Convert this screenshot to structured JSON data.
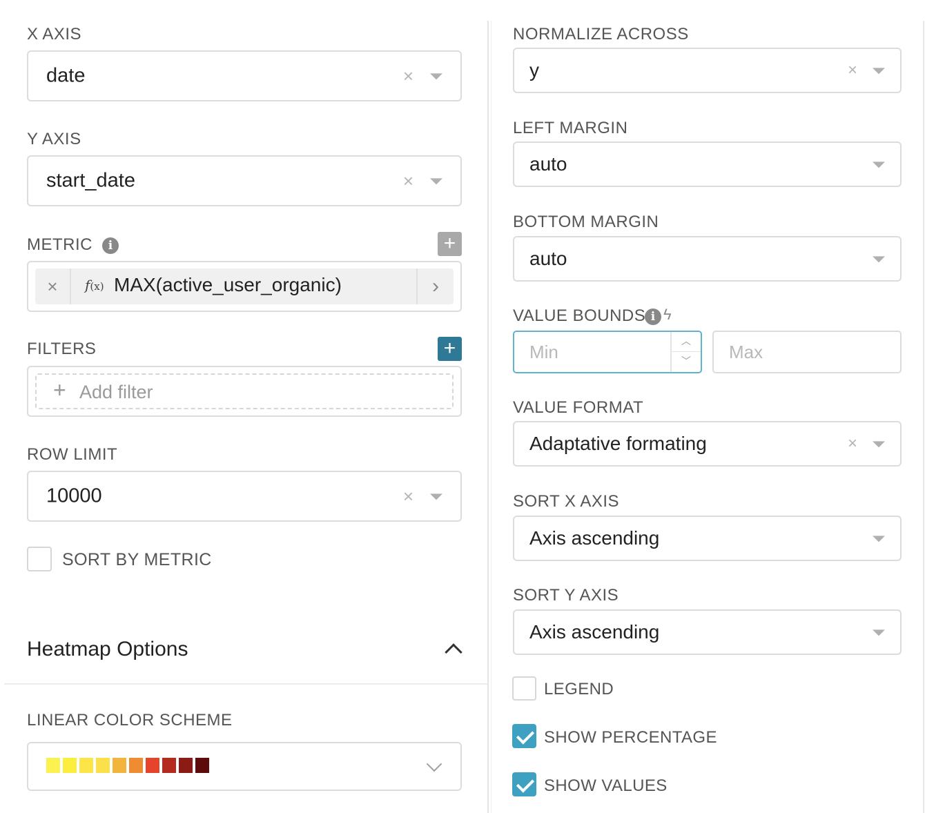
{
  "left": {
    "x_axis": {
      "label": "X AXIS",
      "value": "date"
    },
    "y_axis": {
      "label": "Y AXIS",
      "value": "start_date"
    },
    "metric": {
      "label": "METRIC",
      "fx": "f",
      "fx_sub": "(x)",
      "value": "MAX(active_user_organic)"
    },
    "filters": {
      "label": "FILTERS",
      "add_label": "Add filter"
    },
    "row_limit": {
      "label": "ROW LIMIT",
      "value": "10000"
    },
    "sort_by_metric": {
      "label": "SORT BY METRIC",
      "checked": false
    },
    "heatmap_options": {
      "title": "Heatmap Options"
    },
    "linear_color_scheme": {
      "label": "LINEAR COLOR SCHEME",
      "swatches": [
        "#fbf150",
        "#fcee3c",
        "#fde548",
        "#fbe04a",
        "#f3b43d",
        "#ee8c32",
        "#e5432b",
        "#b52a1e",
        "#8b1b14",
        "#5c0c0a"
      ]
    }
  },
  "right": {
    "normalize_across": {
      "label": "NORMALIZE ACROSS",
      "value": "y"
    },
    "left_margin": {
      "label": "LEFT MARGIN",
      "value": "auto"
    },
    "bottom_margin": {
      "label": "BOTTOM MARGIN",
      "value": "auto"
    },
    "value_bounds": {
      "label": "VALUE BOUNDS",
      "min_placeholder": "Min",
      "max_placeholder": "Max"
    },
    "value_format": {
      "label": "VALUE FORMAT",
      "value": "Adaptative formating"
    },
    "sort_x_axis": {
      "label": "SORT X AXIS",
      "value": "Axis ascending"
    },
    "sort_y_axis": {
      "label": "SORT Y AXIS",
      "value": "Axis ascending"
    },
    "legend": {
      "label": "LEGEND",
      "checked": false
    },
    "show_percentage": {
      "label": "SHOW PERCENTAGE",
      "checked": true
    },
    "show_values": {
      "label": "SHOW VALUES",
      "checked": true
    }
  },
  "icons": {
    "clear": "×",
    "plus": "+",
    "chevron_right": "›",
    "info": "i",
    "bolt": "ϟ",
    "spin_up": "︿",
    "spin_down": "﹀"
  },
  "colors": {
    "accent": "#3fa1c2",
    "add_filter_button": "#2f7996",
    "add_metric_button": "#a9a9a9"
  }
}
